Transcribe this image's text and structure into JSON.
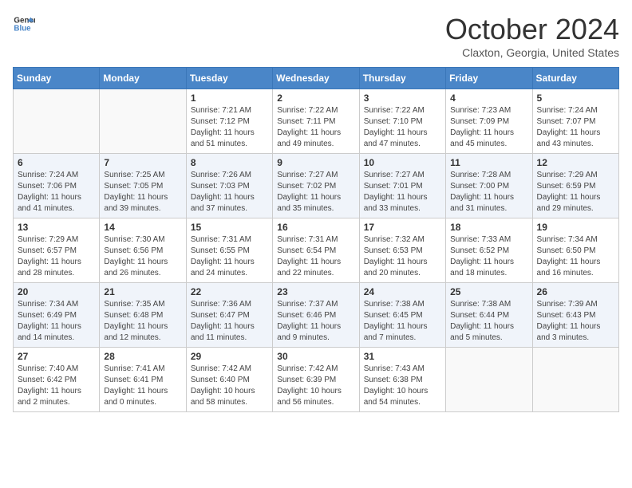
{
  "logo": {
    "line1": "General",
    "line2": "Blue"
  },
  "title": "October 2024",
  "location": "Claxton, Georgia, United States",
  "days_header": [
    "Sunday",
    "Monday",
    "Tuesday",
    "Wednesday",
    "Thursday",
    "Friday",
    "Saturday"
  ],
  "weeks": [
    [
      {
        "day": "",
        "sunrise": "",
        "sunset": "",
        "daylight": ""
      },
      {
        "day": "",
        "sunrise": "",
        "sunset": "",
        "daylight": ""
      },
      {
        "day": "1",
        "sunrise": "Sunrise: 7:21 AM",
        "sunset": "Sunset: 7:12 PM",
        "daylight": "Daylight: 11 hours and 51 minutes."
      },
      {
        "day": "2",
        "sunrise": "Sunrise: 7:22 AM",
        "sunset": "Sunset: 7:11 PM",
        "daylight": "Daylight: 11 hours and 49 minutes."
      },
      {
        "day": "3",
        "sunrise": "Sunrise: 7:22 AM",
        "sunset": "Sunset: 7:10 PM",
        "daylight": "Daylight: 11 hours and 47 minutes."
      },
      {
        "day": "4",
        "sunrise": "Sunrise: 7:23 AM",
        "sunset": "Sunset: 7:09 PM",
        "daylight": "Daylight: 11 hours and 45 minutes."
      },
      {
        "day": "5",
        "sunrise": "Sunrise: 7:24 AM",
        "sunset": "Sunset: 7:07 PM",
        "daylight": "Daylight: 11 hours and 43 minutes."
      }
    ],
    [
      {
        "day": "6",
        "sunrise": "Sunrise: 7:24 AM",
        "sunset": "Sunset: 7:06 PM",
        "daylight": "Daylight: 11 hours and 41 minutes."
      },
      {
        "day": "7",
        "sunrise": "Sunrise: 7:25 AM",
        "sunset": "Sunset: 7:05 PM",
        "daylight": "Daylight: 11 hours and 39 minutes."
      },
      {
        "day": "8",
        "sunrise": "Sunrise: 7:26 AM",
        "sunset": "Sunset: 7:03 PM",
        "daylight": "Daylight: 11 hours and 37 minutes."
      },
      {
        "day": "9",
        "sunrise": "Sunrise: 7:27 AM",
        "sunset": "Sunset: 7:02 PM",
        "daylight": "Daylight: 11 hours and 35 minutes."
      },
      {
        "day": "10",
        "sunrise": "Sunrise: 7:27 AM",
        "sunset": "Sunset: 7:01 PM",
        "daylight": "Daylight: 11 hours and 33 minutes."
      },
      {
        "day": "11",
        "sunrise": "Sunrise: 7:28 AM",
        "sunset": "Sunset: 7:00 PM",
        "daylight": "Daylight: 11 hours and 31 minutes."
      },
      {
        "day": "12",
        "sunrise": "Sunrise: 7:29 AM",
        "sunset": "Sunset: 6:59 PM",
        "daylight": "Daylight: 11 hours and 29 minutes."
      }
    ],
    [
      {
        "day": "13",
        "sunrise": "Sunrise: 7:29 AM",
        "sunset": "Sunset: 6:57 PM",
        "daylight": "Daylight: 11 hours and 28 minutes."
      },
      {
        "day": "14",
        "sunrise": "Sunrise: 7:30 AM",
        "sunset": "Sunset: 6:56 PM",
        "daylight": "Daylight: 11 hours and 26 minutes."
      },
      {
        "day": "15",
        "sunrise": "Sunrise: 7:31 AM",
        "sunset": "Sunset: 6:55 PM",
        "daylight": "Daylight: 11 hours and 24 minutes."
      },
      {
        "day": "16",
        "sunrise": "Sunrise: 7:31 AM",
        "sunset": "Sunset: 6:54 PM",
        "daylight": "Daylight: 11 hours and 22 minutes."
      },
      {
        "day": "17",
        "sunrise": "Sunrise: 7:32 AM",
        "sunset": "Sunset: 6:53 PM",
        "daylight": "Daylight: 11 hours and 20 minutes."
      },
      {
        "day": "18",
        "sunrise": "Sunrise: 7:33 AM",
        "sunset": "Sunset: 6:52 PM",
        "daylight": "Daylight: 11 hours and 18 minutes."
      },
      {
        "day": "19",
        "sunrise": "Sunrise: 7:34 AM",
        "sunset": "Sunset: 6:50 PM",
        "daylight": "Daylight: 11 hours and 16 minutes."
      }
    ],
    [
      {
        "day": "20",
        "sunrise": "Sunrise: 7:34 AM",
        "sunset": "Sunset: 6:49 PM",
        "daylight": "Daylight: 11 hours and 14 minutes."
      },
      {
        "day": "21",
        "sunrise": "Sunrise: 7:35 AM",
        "sunset": "Sunset: 6:48 PM",
        "daylight": "Daylight: 11 hours and 12 minutes."
      },
      {
        "day": "22",
        "sunrise": "Sunrise: 7:36 AM",
        "sunset": "Sunset: 6:47 PM",
        "daylight": "Daylight: 11 hours and 11 minutes."
      },
      {
        "day": "23",
        "sunrise": "Sunrise: 7:37 AM",
        "sunset": "Sunset: 6:46 PM",
        "daylight": "Daylight: 11 hours and 9 minutes."
      },
      {
        "day": "24",
        "sunrise": "Sunrise: 7:38 AM",
        "sunset": "Sunset: 6:45 PM",
        "daylight": "Daylight: 11 hours and 7 minutes."
      },
      {
        "day": "25",
        "sunrise": "Sunrise: 7:38 AM",
        "sunset": "Sunset: 6:44 PM",
        "daylight": "Daylight: 11 hours and 5 minutes."
      },
      {
        "day": "26",
        "sunrise": "Sunrise: 7:39 AM",
        "sunset": "Sunset: 6:43 PM",
        "daylight": "Daylight: 11 hours and 3 minutes."
      }
    ],
    [
      {
        "day": "27",
        "sunrise": "Sunrise: 7:40 AM",
        "sunset": "Sunset: 6:42 PM",
        "daylight": "Daylight: 11 hours and 2 minutes."
      },
      {
        "day": "28",
        "sunrise": "Sunrise: 7:41 AM",
        "sunset": "Sunset: 6:41 PM",
        "daylight": "Daylight: 11 hours and 0 minutes."
      },
      {
        "day": "29",
        "sunrise": "Sunrise: 7:42 AM",
        "sunset": "Sunset: 6:40 PM",
        "daylight": "Daylight: 10 hours and 58 minutes."
      },
      {
        "day": "30",
        "sunrise": "Sunrise: 7:42 AM",
        "sunset": "Sunset: 6:39 PM",
        "daylight": "Daylight: 10 hours and 56 minutes."
      },
      {
        "day": "31",
        "sunrise": "Sunrise: 7:43 AM",
        "sunset": "Sunset: 6:38 PM",
        "daylight": "Daylight: 10 hours and 54 minutes."
      },
      {
        "day": "",
        "sunrise": "",
        "sunset": "",
        "daylight": ""
      },
      {
        "day": "",
        "sunrise": "",
        "sunset": "",
        "daylight": ""
      }
    ]
  ]
}
